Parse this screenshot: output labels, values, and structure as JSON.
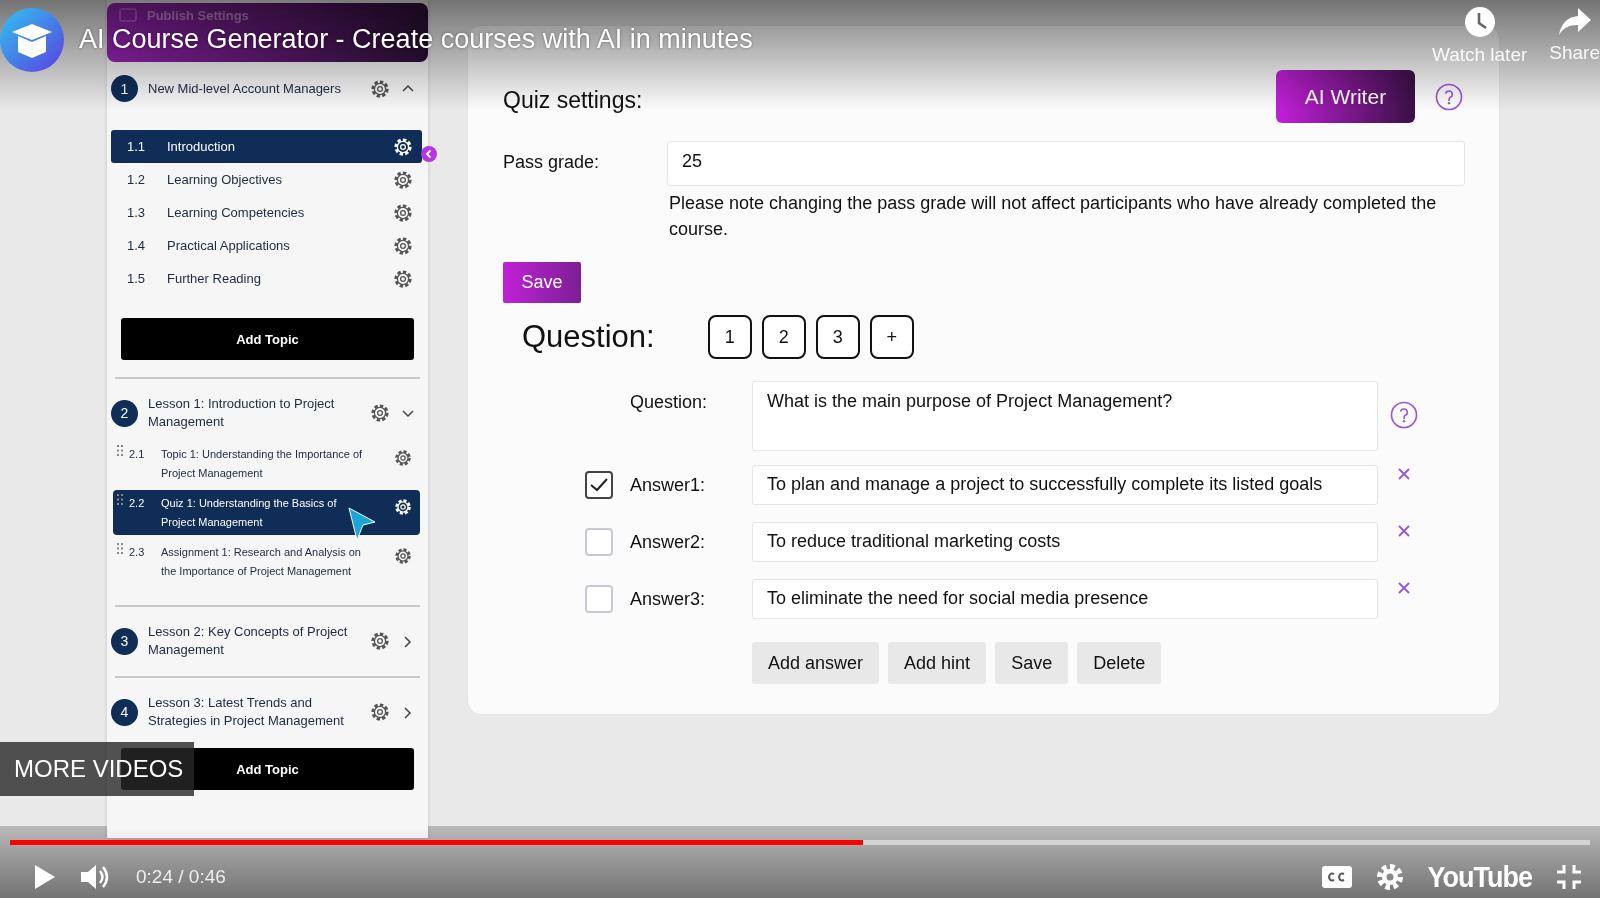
{
  "player": {
    "title": "AI Course Generator - Create courses with AI in minutes",
    "actions": [
      {
        "kind": "clock",
        "label": "Watch later"
      },
      {
        "kind": "share",
        "label": "Share"
      }
    ],
    "more_videos": "MORE VIDEOS",
    "progress": {
      "level": 0.54
    },
    "time": "0:24 / 0:46",
    "logo": "YouTube"
  },
  "sidebar": {
    "header": "Publish Settings",
    "sections": [
      {
        "number": "1",
        "title": "New Mid-level Account Managers",
        "kind": "up",
        "items": [
          {
            "number": "1.1",
            "label": "Introduction",
            "selected": true,
            "handle": false
          },
          {
            "number": "1.2",
            "label": "Learning Objectives",
            "selected": false,
            "handle": false
          },
          {
            "number": "1.3",
            "label": "Learning Competencies",
            "selected": false,
            "handle": false
          },
          {
            "number": "1.4",
            "label": "Practical Applications",
            "selected": false,
            "handle": false
          },
          {
            "number": "1.5",
            "label": "Further Reading",
            "selected": false,
            "handle": false
          }
        ],
        "add_button": "Add Topic"
      },
      {
        "number": "2",
        "title": "Lesson 1: Introduction to Project Management",
        "kind": "down",
        "items": [
          {
            "number": "2.1",
            "label": "Topic 1: Understanding the Importance of Project Management",
            "selected": false,
            "handle": true
          },
          {
            "number": "2.2",
            "label": "Quiz 1: Understanding the Basics of Project Management",
            "selected": true,
            "handle": true
          },
          {
            "number": "2.3",
            "label": "Assignment 1: Research and Analysis on the Importance of Project Management",
            "selected": false,
            "handle": true
          }
        ]
      },
      {
        "number": "3",
        "title": "Lesson 2: Key Concepts of Project Management",
        "kind": "right"
      },
      {
        "number": "4",
        "title": "Lesson 3: Latest Trends and Strategies in Project Management",
        "kind": "right",
        "add_button": "Add Topic"
      }
    ]
  },
  "quiz_settings": {
    "heading": "Quiz settings:",
    "ai_button": "AI Writer",
    "pass_grade": {
      "label": "Pass grade:",
      "value": "25"
    },
    "note": "Please note changing the pass grade will not affect participants who have already completed the course.",
    "save": "Save"
  },
  "question_editor": {
    "heading": "Question:",
    "tabs": [
      {
        "label": "1",
        "selected": false
      },
      {
        "label": "2",
        "selected": false
      },
      {
        "label": "3",
        "selected": false
      },
      {
        "label": "+",
        "selected": false
      }
    ],
    "question": {
      "label": "Question:",
      "value": "What is the main purpose of Project Management?"
    },
    "answers": [
      {
        "label": "Answer1:",
        "value": "To plan and manage a project to successfully complete its listed goals",
        "checked": true
      },
      {
        "label": "Answer2:",
        "value": "To reduce traditional marketing costs",
        "checked": false
      },
      {
        "label": "Answer3:",
        "value": "To eliminate the need for social media presence",
        "checked": false
      }
    ],
    "buttons": [
      "Add answer",
      "Add hint",
      "Save",
      "Delete"
    ]
  }
}
